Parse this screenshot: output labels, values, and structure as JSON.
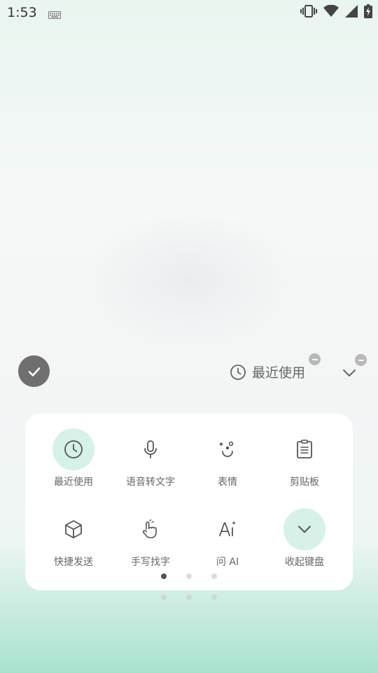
{
  "status_bar": {
    "time": "1:53",
    "icons": [
      "keyboard-icon",
      "vibrate-icon",
      "wifi-icon",
      "signal-icon",
      "battery-charging-icon"
    ]
  },
  "toolbar": {
    "recent_label": "最近使用"
  },
  "panel": {
    "items": [
      {
        "label": "最近使用",
        "icon": "clock-icon",
        "active": true
      },
      {
        "label": "语音转文字",
        "icon": "microphone-icon",
        "active": false
      },
      {
        "label": "表情",
        "icon": "emoji-icon",
        "active": false
      },
      {
        "label": "剪贴板",
        "icon": "clipboard-icon",
        "active": false
      },
      {
        "label": "快捷发送",
        "icon": "box-icon",
        "active": false
      },
      {
        "label": "手写找字",
        "icon": "handwriting-icon",
        "active": false
      },
      {
        "label": "问 AI",
        "icon": "ai-icon",
        "active": false
      },
      {
        "label": "收起键盘",
        "icon": "chevron-down-icon",
        "active": true
      }
    ],
    "page_count": 3,
    "current_page": 1
  },
  "colors": {
    "accent_soft": "#d5f1e8",
    "check_button": "#6f6f6f",
    "icon": "#555555"
  }
}
